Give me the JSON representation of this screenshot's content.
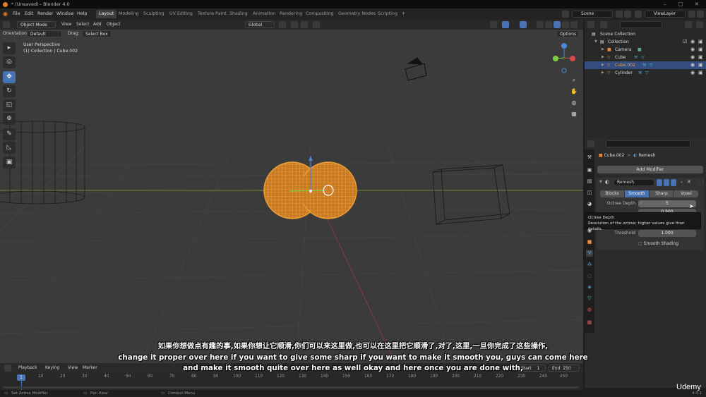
{
  "window": {
    "title": "* (Unsaved) - Blender 4.0",
    "controls": [
      "–",
      "□",
      "✕"
    ]
  },
  "menu": {
    "items": [
      "File",
      "Edit",
      "Render",
      "Window",
      "Help"
    ],
    "workspaces": [
      "Layout",
      "Modeling",
      "Sculpting",
      "UV Editing",
      "Texture Paint",
      "Shading",
      "Animation",
      "Rendering",
      "Compositing",
      "Geometry Nodes",
      "Scripting"
    ],
    "scene": "Scene",
    "view_layer": "ViewLayer"
  },
  "viewport_header": {
    "mode": "Object Mode",
    "menus": [
      "View",
      "Select",
      "Add",
      "Object"
    ],
    "orientation_label": "Orientation:",
    "orientation_value": "Default",
    "drag_label": "Drag:",
    "drag_value": "Select Box",
    "transform_orientation": "Global",
    "options_label": "Options"
  },
  "viewport": {
    "view_name": "User Perspective",
    "collection_info": "(1) Collection | Cube.002"
  },
  "outliner": {
    "rows": [
      {
        "name": "Scene Collection",
        "selected": false
      },
      {
        "name": "Collection",
        "selected": false
      },
      {
        "name": "Camera",
        "selected": false
      },
      {
        "name": "Cube",
        "selected": false
      },
      {
        "name": "Cube.002",
        "selected": true
      },
      {
        "name": "Cylinder",
        "selected": false
      }
    ]
  },
  "properties": {
    "breadcrumb_object": "Cube.002",
    "breadcrumb_modifier": "Remesh",
    "add_modifier": "Add Modifier",
    "modifier_name": "Remesh",
    "modes": [
      "Blocks",
      "Smooth",
      "Sharp",
      "Voxel"
    ],
    "active_mode": "Smooth",
    "octree_depth_label": "Octree Depth",
    "octree_depth_value": "5",
    "scale_value": "0.900",
    "threshold_label": "Threshold",
    "threshold_value": "1.000",
    "smooth_shading_label": "Smooth Shading"
  },
  "tooltip": {
    "title": "Octree Depth",
    "text": "Resolution of the octree; higher values give finer details."
  },
  "timeline": {
    "menus": [
      "Playback",
      "Keying",
      "View",
      "Marker"
    ],
    "start_label": "Start",
    "start_value": "1",
    "end_label": "End",
    "end_value": "250",
    "current_frame": "1",
    "ticks": [
      "10",
      "20",
      "30",
      "40",
      "50",
      "60",
      "70",
      "80",
      "90",
      "100",
      "110",
      "120",
      "130",
      "140",
      "150",
      "160",
      "170",
      "180",
      "190",
      "200",
      "210",
      "220",
      "230",
      "240",
      "250"
    ]
  },
  "statusbar": {
    "items": [
      "Set Active Modifier",
      "Pan View",
      "Context Menu"
    ],
    "version": "4.0.1"
  },
  "subtitles": {
    "line1": "如果你想做点有趣的事,如果你想让它顺滑,你们可以来这里做,也可以在这里把它顺滑了,对了,这里,一旦你完成了这些操作,",
    "line2": "change it proper over here if you want to give some sharp if you want to make it smooth you, guys can come here",
    "line3": "and make it smooth quite over here as well okay and here once you are done with,"
  },
  "watermark": "Udemy",
  "colors": {
    "accent": "#4772b3",
    "selection": "#f0a030",
    "viewport_bg": "#3b3b3b",
    "panel_bg": "#2b2b2b"
  }
}
